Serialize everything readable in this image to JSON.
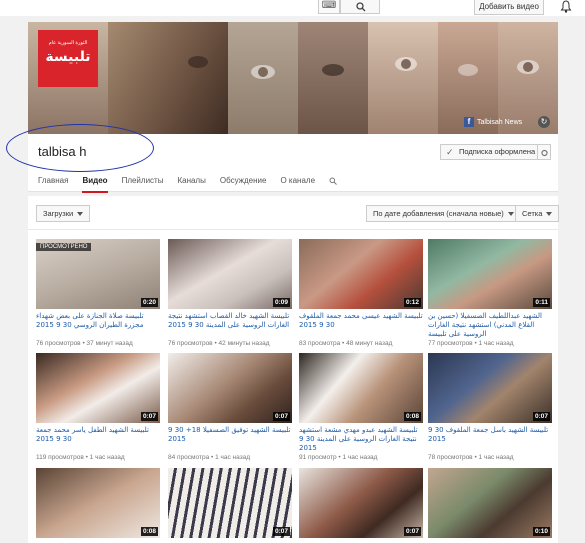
{
  "header": {
    "keyboard_icon": "keyboard-icon",
    "search_icon": "search-icon",
    "add_video_label": "Добавить видео",
    "bell_icon": "bell-icon"
  },
  "banner": {
    "logo_small_text": "الثورة السورية عام",
    "logo_title": "تلبيسة",
    "fb_label": "Talbisah News"
  },
  "channel": {
    "name": "talbisa h",
    "subscribe_label": "Подписка оформлена",
    "tabs": [
      "Главная",
      "Видео",
      "Плейлисты",
      "Каналы",
      "Обсуждение",
      "О канале"
    ],
    "active_tab": "Видео"
  },
  "filters": {
    "uploads_label": "Загрузки",
    "sort_label": "По дате добавления (сначала новые)",
    "grid_label": "Сетка"
  },
  "videos": [
    {
      "duration": "0:20",
      "badge": "ПРОСМОТРЕНО",
      "title": "تلبيسة صلاة الجنازة على بعض شهداء مجزرة الطيران الروسي 30 9 2015",
      "views": "76 просмотров",
      "time": "37 минут назад"
    },
    {
      "duration": "0:09",
      "badge": "",
      "title": "تلبيسة الشهيد خالد القصاب استشهد نتيجة الغارات الروسية على المدينة 30 9 2015",
      "views": "76 просмотров",
      "time": "42 минуты назад"
    },
    {
      "duration": "0:12",
      "badge": "",
      "title": "تلبيسة الشهيد عيسى محمد جمعة الملقوف 30 9 2015",
      "views": "83 просмотра",
      "time": "48 минут назад"
    },
    {
      "duration": "0:11",
      "badge": "",
      "title": "الشهيد عبداللطيف الصسفيلا (حسين بن القلاع المدني) استشهد نتيجة الغارات الروسية على تلبيسة",
      "views": "77 просмотров",
      "time": "1 час назад"
    },
    {
      "duration": "0:07",
      "badge": "",
      "title": "تلبيسة الشهيد الطفل ياسر محمد جمعة 30 9 2015",
      "views": "119 просмотров",
      "time": "1 час назад"
    },
    {
      "duration": "0:07",
      "badge": "",
      "title": "تلبيسة الشهيد توفيق الصسفيلا 18+ 30 9 2015",
      "views": "84 просмотра",
      "time": "1 час назад"
    },
    {
      "duration": "0:08",
      "badge": "",
      "title": "تلبيسة الشهيد عبدو مهدي مشعة استشهد نتيجة الغارات الروسية على المدينة 30 9 2015",
      "views": "91 просмотр",
      "time": "1 час назад"
    },
    {
      "duration": "0:07",
      "badge": "",
      "title": "تلبيسة الشهيد باسل جمعة الملقوف 30 9 2015",
      "views": "78 просмотров",
      "time": "1 час назад"
    },
    {
      "duration": "0:08",
      "badge": "",
      "title": "",
      "views": "",
      "time": ""
    },
    {
      "duration": "0:07",
      "badge": "",
      "title": "",
      "views": "",
      "time": ""
    },
    {
      "duration": "0:07",
      "badge": "",
      "title": "",
      "views": "",
      "time": ""
    },
    {
      "duration": "0:10",
      "badge": "",
      "title": "",
      "views": "",
      "time": ""
    }
  ]
}
